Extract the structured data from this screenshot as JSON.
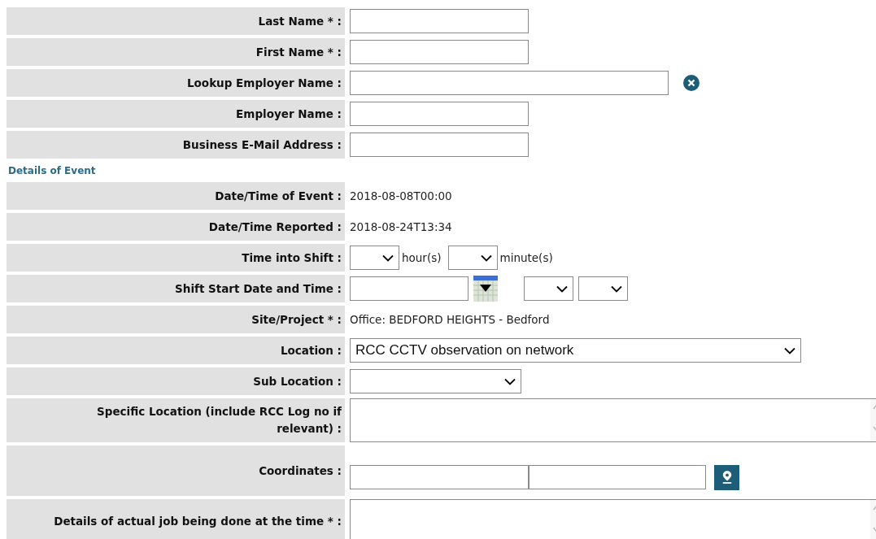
{
  "person_fields": [
    {
      "kind": "input",
      "label": "Last Name * :"
    },
    {
      "kind": "input",
      "label": "First Name * :"
    },
    {
      "kind": "lookup",
      "label": "Lookup Employer Name :"
    },
    {
      "kind": "input",
      "label": "Employer Name :"
    },
    {
      "kind": "input",
      "label": "Business E-Mail Address :"
    }
  ],
  "event_section": {
    "heading": "Details of Event",
    "fields": [
      {
        "kind": "text",
        "label": "Date/Time of Event :",
        "value": "2018-08-08T00:00"
      },
      {
        "kind": "text",
        "label": "Date/Time Reported :",
        "value": "2018-08-24T13:34"
      },
      {
        "kind": "duration",
        "label": "Time into Shift :",
        "units": [
          "hour(s)",
          "minute(s)"
        ]
      },
      {
        "kind": "datetime",
        "label": "Shift Start Date and Time :"
      },
      {
        "kind": "text",
        "label": "Site/Project * :",
        "value": "Office: BEDFORD HEIGHTS - Bedford"
      },
      {
        "kind": "wide_select",
        "label": "Location :",
        "value": "RCC CCTV observation on network"
      },
      {
        "kind": "select",
        "label": "Sub Location :"
      },
      {
        "kind": "textarea",
        "label": "Specific Location (include RCC Log no if relevant) :"
      },
      {
        "kind": "coordinates",
        "label": "Coordinates :"
      },
      {
        "kind": "textarea",
        "label": "Details of actual job being done at the time * :"
      }
    ]
  }
}
